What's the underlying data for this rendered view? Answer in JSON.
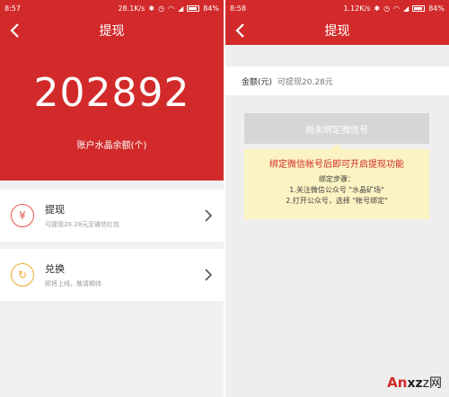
{
  "left": {
    "status": {
      "time": "8:57",
      "speed": "28.1K/s",
      "battery": "84%"
    },
    "title": "提现",
    "balance": {
      "value": "202892",
      "label": "账户水晶余额(个)"
    },
    "options": [
      {
        "title": "提现",
        "subtitle": "可提现20.28元至微信红包",
        "icon_glyph": "¥"
      },
      {
        "title": "兑换",
        "subtitle": "即将上线，敬请期待",
        "icon_glyph": "↻"
      }
    ]
  },
  "right": {
    "status": {
      "time": "8:58",
      "speed": "1.12K/s",
      "battery": "84%"
    },
    "title": "提现",
    "amount": {
      "label": "金额(元)",
      "hint": "可提现20.28元"
    },
    "bind_button": "尚未绑定微信号",
    "notice": {
      "title": "绑定微信帐号后即可开启提现功能",
      "steps_title": "绑定步骤：",
      "step1": "1.关注微信公众号 \"水晶矿场\"",
      "step2": "2.打开公众号，选择 \"帐号绑定\""
    }
  },
  "watermark": {
    "a": "An",
    "rest": "xz",
    "tail": "z网"
  },
  "colors": {
    "brand_red": "#d22a2a",
    "notice_bg": "#fbf3c2"
  }
}
